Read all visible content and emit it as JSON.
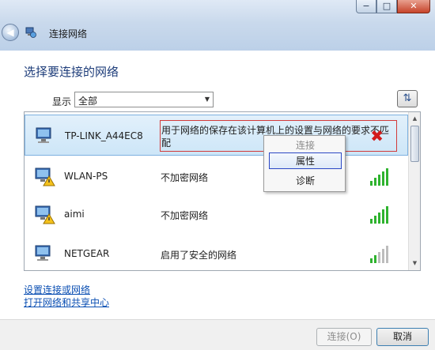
{
  "window": {
    "title": "连接网络",
    "controls": {
      "minimize": "−",
      "maximize": "□",
      "close": "✕"
    }
  },
  "heading": "选择要连接的网络",
  "filter": {
    "label": "显示",
    "selected": "全部"
  },
  "networks": [
    {
      "name": "TP-LINK_A44EC8",
      "status": "用于网络的保存在该计算机上的设置与网络的要求不匹配",
      "signal_bars": 0,
      "state": "error"
    },
    {
      "name": "WLAN-PS",
      "status": "不加密网络",
      "signal_bars": 5,
      "state": "open"
    },
    {
      "name": "aimi",
      "status": "不加密网络",
      "signal_bars": 5,
      "state": "open"
    },
    {
      "name": "NETGEAR",
      "status": "启用了安全的网络",
      "signal_bars": 2,
      "state": "secure"
    }
  ],
  "context_menu": {
    "items": [
      "连接",
      "属性",
      "诊断"
    ],
    "disabled": "连接",
    "focused": "属性"
  },
  "links": [
    "设置连接或网络",
    "打开网络和共享中心"
  ],
  "buttons": {
    "connect": "连接(O)",
    "cancel": "取消"
  },
  "colors": {
    "link": "#0b4fb3",
    "heading": "#1e3d7a",
    "signal_on": "#2fb32f",
    "error": "#d21b1b"
  }
}
